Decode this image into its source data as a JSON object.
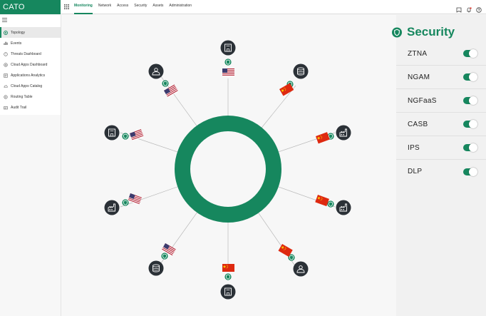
{
  "app": {
    "logo": "CATO"
  },
  "nav": [
    "Monitoring",
    "Network",
    "Access",
    "Security",
    "Assets",
    "Administration"
  ],
  "sidebar": {
    "items": [
      {
        "label": "Topology",
        "icon": "topology-icon",
        "active": true
      },
      {
        "label": "Events",
        "icon": "events-icon"
      },
      {
        "label": "Threats Dashboard",
        "icon": "threats-icon"
      },
      {
        "label": "Cloud Apps Dashboard",
        "icon": "cloud-apps-icon"
      },
      {
        "label": "Applications Analytics",
        "icon": "analytics-icon"
      },
      {
        "label": "Cloud Apps Catalog",
        "icon": "catalog-icon"
      },
      {
        "label": "Routing Table",
        "icon": "routing-icon"
      },
      {
        "label": "Audit Trail",
        "icon": "audit-icon"
      }
    ]
  },
  "security": {
    "title": "Security",
    "features": [
      {
        "label": "ZTNA",
        "enabled": true
      },
      {
        "label": "NGAM",
        "enabled": true
      },
      {
        "label": "NGFaaS",
        "enabled": true
      },
      {
        "label": "CASB",
        "enabled": true
      },
      {
        "label": "IPS",
        "enabled": true
      },
      {
        "label": "DLP",
        "enabled": true
      }
    ]
  },
  "topology": {
    "nodes": [
      {
        "name": "top",
        "icon": "building-icon",
        "flag": "us"
      },
      {
        "name": "top-right",
        "icon": "database-icon",
        "flag": "cn"
      },
      {
        "name": "right-upper",
        "icon": "factory-icon",
        "flag": "cn"
      },
      {
        "name": "right-lower",
        "icon": "factory-icon",
        "flag": "cn"
      },
      {
        "name": "bottom-right",
        "icon": "user-icon",
        "flag": "cn"
      },
      {
        "name": "bottom",
        "icon": "building-icon",
        "flag": "cn"
      },
      {
        "name": "bottom-left",
        "icon": "database-icon",
        "flag": "us"
      },
      {
        "name": "left-lower",
        "icon": "factory-icon",
        "flag": "us"
      },
      {
        "name": "left-upper",
        "icon": "building-icon",
        "flag": "us"
      },
      {
        "name": "top-left",
        "icon": "user-icon",
        "flag": "us"
      }
    ]
  },
  "colors": {
    "brand": "#16875e",
    "node": "#2b3137",
    "cn_flag": "#de2910",
    "us_flag": "#b22234"
  }
}
